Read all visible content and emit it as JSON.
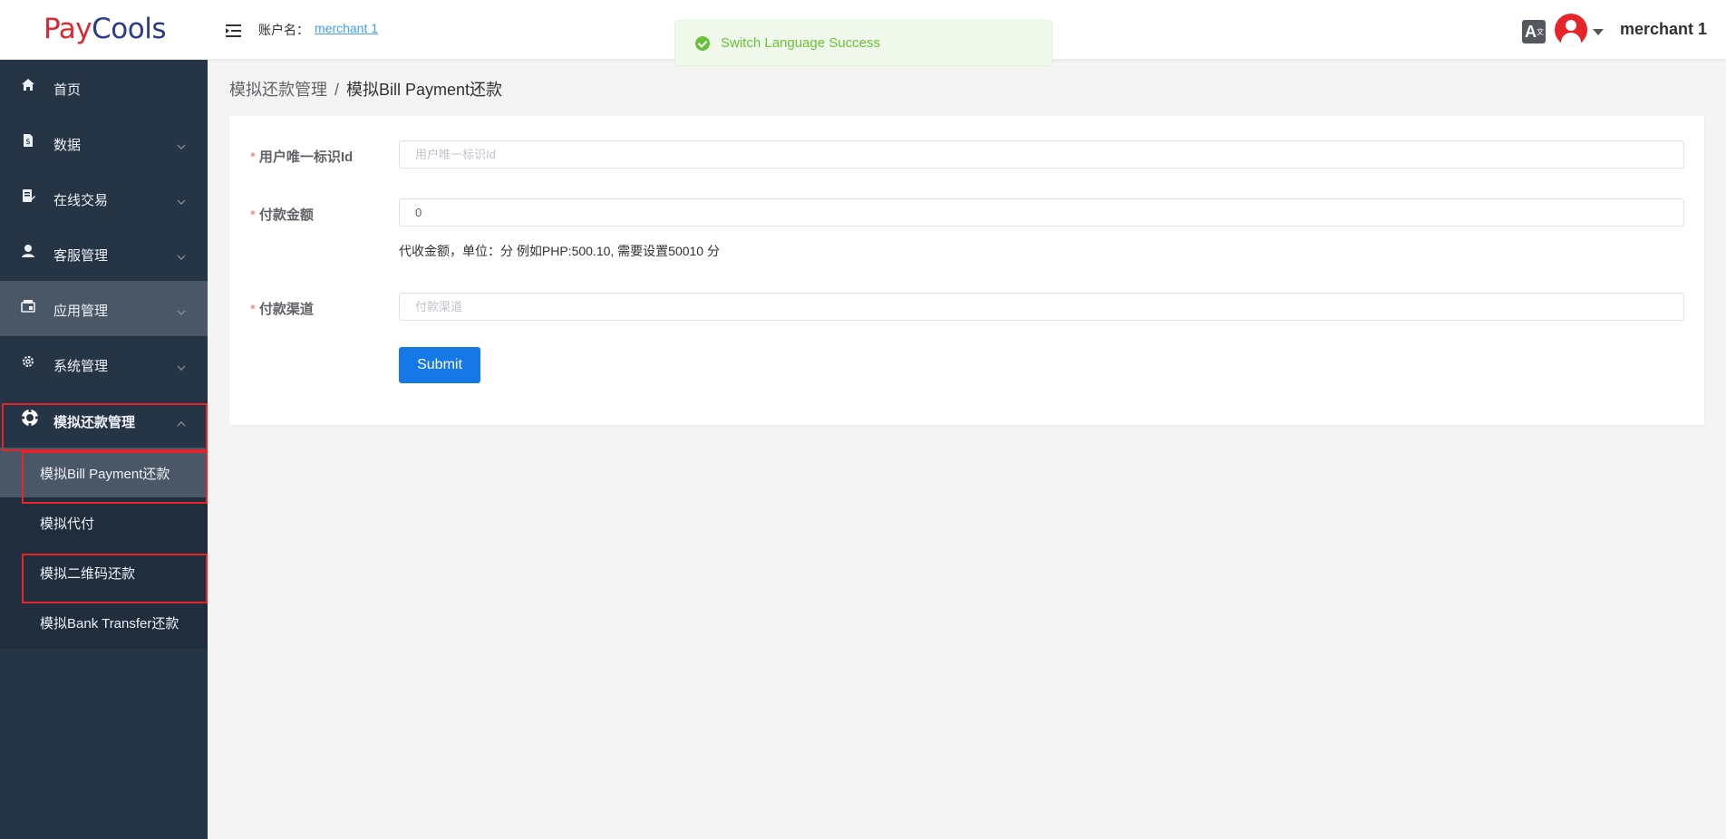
{
  "header": {
    "logo_pay": "Pay",
    "logo_cools": "Cools",
    "account_label": "账户名：",
    "account_name": "merchant 1",
    "toast_message": "Switch Language Success",
    "lang_icon_text": "A",
    "lang_icon_sup": "文",
    "user_name": "merchant 1"
  },
  "sidebar": {
    "items": [
      {
        "label": "首页",
        "icon": "home-icon"
      },
      {
        "label": "数据",
        "icon": "document-dollar-icon"
      },
      {
        "label": "在线交易",
        "icon": "edit-list-icon"
      },
      {
        "label": "客服管理",
        "icon": "customer-service-icon"
      },
      {
        "label": "应用管理",
        "icon": "app-store-icon"
      },
      {
        "label": "系统管理",
        "icon": "gear-icon"
      },
      {
        "label": "模拟还款管理",
        "icon": "lifebuoy-icon"
      }
    ],
    "submenu": [
      {
        "label": "模拟Bill Payment还款"
      },
      {
        "label": "模拟代付"
      },
      {
        "label": "模拟二维码还款"
      },
      {
        "label": "模拟Bank Transfer还款"
      }
    ]
  },
  "breadcrumb": {
    "parent": "模拟还款管理",
    "separator": "/",
    "current": "模拟Bill Payment还款"
  },
  "form": {
    "user_id_label": "用户唯一标识Id",
    "user_id_placeholder": "用户唯一标识Id",
    "user_id_value": "",
    "amount_label": "付款金额",
    "amount_value": "0",
    "amount_hint": "代收金额，单位：分 例如PHP:500.10, 需要设置50010 分",
    "channel_label": "付款渠道",
    "channel_placeholder": "付款渠道",
    "channel_value": "",
    "submit_label": "Submit",
    "required_mark": "*"
  },
  "colors": {
    "sidebar_bg": "#263546",
    "submenu_bg": "#1f2d3d",
    "active_bg": "#4a5767",
    "primary_button": "#1677e6",
    "highlight_box": "#e8242b",
    "success": "#67c23a"
  }
}
